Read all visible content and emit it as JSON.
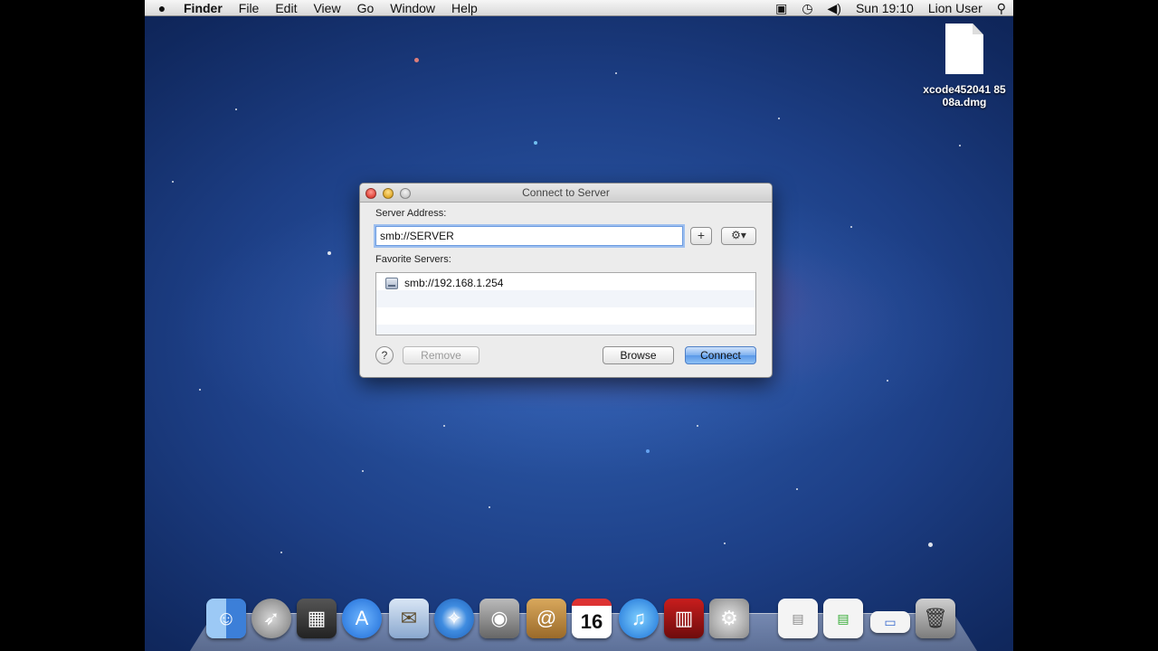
{
  "menubar": {
    "apple_icon": "apple-logo-icon",
    "app_name": "Finder",
    "menus": [
      "File",
      "Edit",
      "View",
      "Go",
      "Window",
      "Help"
    ],
    "clock": "Sun 19:10",
    "user": "Lion User"
  },
  "desktop": {
    "file_name": "xcode452041 8508a.dmg"
  },
  "dialog": {
    "title": "Connect to Server",
    "server_address_label": "Server Address:",
    "server_address_value": "smb://SERVER",
    "plus_label": "+",
    "gear_label": "⚙▾",
    "favorite_servers_label": "Favorite Servers:",
    "favorites": [
      "smb://192.168.1.254"
    ],
    "help_label": "?",
    "remove_label": "Remove",
    "browse_label": "Browse",
    "connect_label": "Connect"
  },
  "dock": {
    "calendar_day": "16",
    "icons": [
      "finder-icon",
      "launchpad-icon",
      "mission-control-icon",
      "app-store-icon",
      "mail-icon",
      "safari-icon",
      "facetime-icon",
      "address-book-icon",
      "calendar-icon",
      "itunes-icon",
      "photo-booth-icon",
      "system-preferences-icon",
      "document-icon",
      "document-icon",
      "document-icon",
      "trash-icon"
    ]
  }
}
